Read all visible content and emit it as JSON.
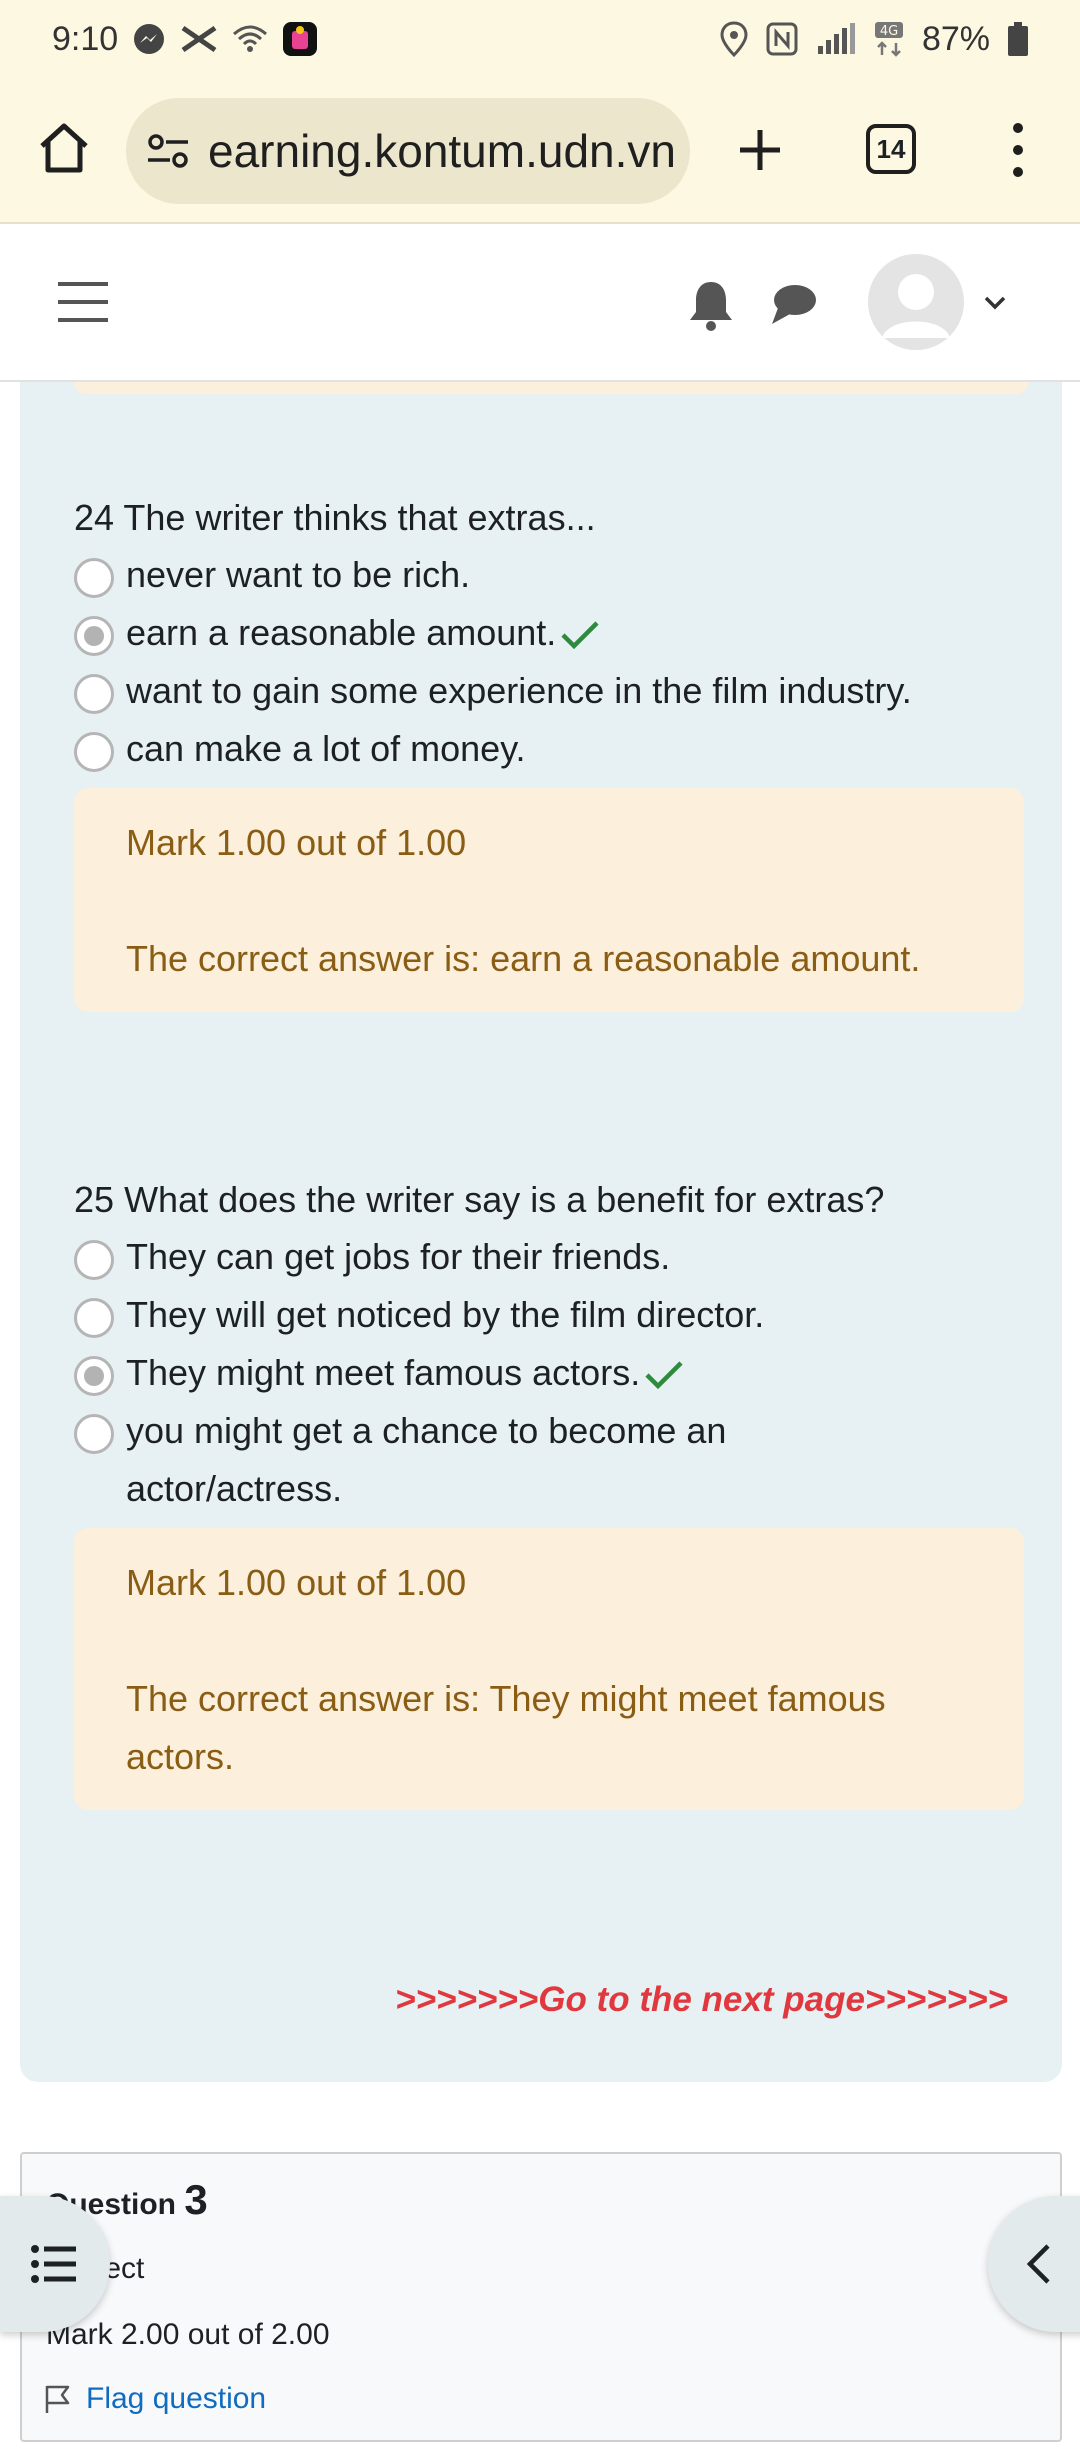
{
  "status_bar": {
    "time": "9:10",
    "battery": "87%",
    "network": "4G"
  },
  "browser": {
    "url": "earning.kontum.udn.vn",
    "tab_count": "14"
  },
  "questions": [
    {
      "number": "24",
      "text": "The writer thinks that extras...",
      "options": [
        {
          "label": "never want to be rich.",
          "checked": false,
          "correct": false
        },
        {
          "label": "earn a reasonable amount.",
          "checked": true,
          "correct": true
        },
        {
          "label": "want to gain some experience in the film industry.",
          "checked": false,
          "correct": false
        },
        {
          "label": "can make a lot of money.",
          "checked": false,
          "correct": false
        }
      ],
      "mark": "Mark 1.00 out of 1.00",
      "correct_answer": "The correct answer is: earn a reasonable amount."
    },
    {
      "number": "25",
      "text": "What does the writer say is a benefit for extras?",
      "options": [
        {
          "label": "They can get jobs for their friends.",
          "checked": false,
          "correct": false
        },
        {
          "label": "They will get noticed by the film director.",
          "checked": false,
          "correct": false
        },
        {
          "label": "They might meet famous actors.",
          "checked": true,
          "correct": true
        },
        {
          "label": "you might get a chance to become an actor/actress.",
          "checked": false,
          "correct": false
        }
      ],
      "mark": "Mark 1.00 out of 1.00",
      "correct_answer": "The correct answer is: They might meet famous actors."
    }
  ],
  "next_page_link": ">>>>>>>Go to the next page>>>>>>>",
  "question_info": {
    "label": "Question",
    "number": "3",
    "state": "Correct",
    "grade": "Mark 2.00 out of 2.00",
    "flag_label": "Flag question"
  },
  "colors": {
    "panel_bg": "#e7f1f3",
    "feedback_bg": "#fcefdc",
    "feedback_text": "#8a5d14",
    "check_green": "#2e8b3e",
    "link_red": "#e0383e",
    "link_blue": "#0f6cbf"
  }
}
